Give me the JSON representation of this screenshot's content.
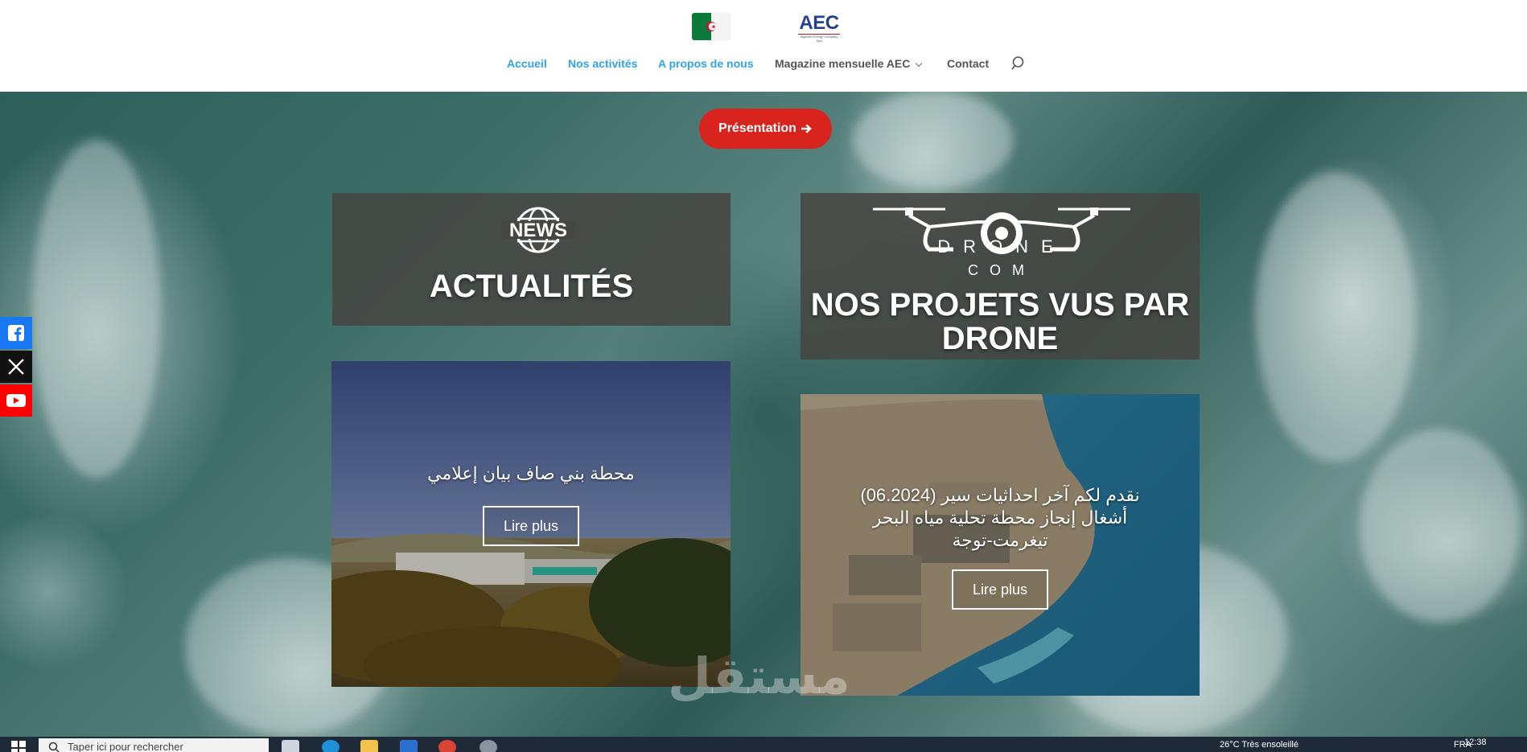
{
  "nav": {
    "items": [
      {
        "label": "Accueil"
      },
      {
        "label": "Nos activités"
      },
      {
        "label": "A propos de nous"
      },
      {
        "label": "Magazine mensuelle AEC"
      },
      {
        "label": "Contact"
      }
    ]
  },
  "logo": {
    "text": "AEC",
    "tagline": "Algerian Energy Company Spa"
  },
  "hero": {
    "cta_label": "Présentation",
    "news": {
      "icon_text": "NEWS",
      "title": "ACTUALITÉS"
    },
    "drone": {
      "icon_text": "DRONE",
      "icon_sub": "COM",
      "title": "NOS PROJETS VUS PAR DRONE"
    },
    "card1": {
      "text": "محطة بني صاف بيان إعلامي",
      "button": "Lire plus"
    },
    "card2": {
      "text": "نقدم لكم آخر احداثيات سير (06.2024) أشغال إنجاز محطة تحلية مياه البحر تيغرمت-توجة",
      "button": "Lire plus"
    },
    "watermark": "مستقل"
  },
  "taskbar": {
    "search_placeholder": "Taper ici pour rechercher",
    "weather": "26°C  Très ensoleillé",
    "lang": "FRA",
    "time": "12:38"
  },
  "colors": {
    "accent_blue": "#2ea3f2",
    "cta_red": "#d9241d",
    "aec_blue": "#23418c"
  }
}
